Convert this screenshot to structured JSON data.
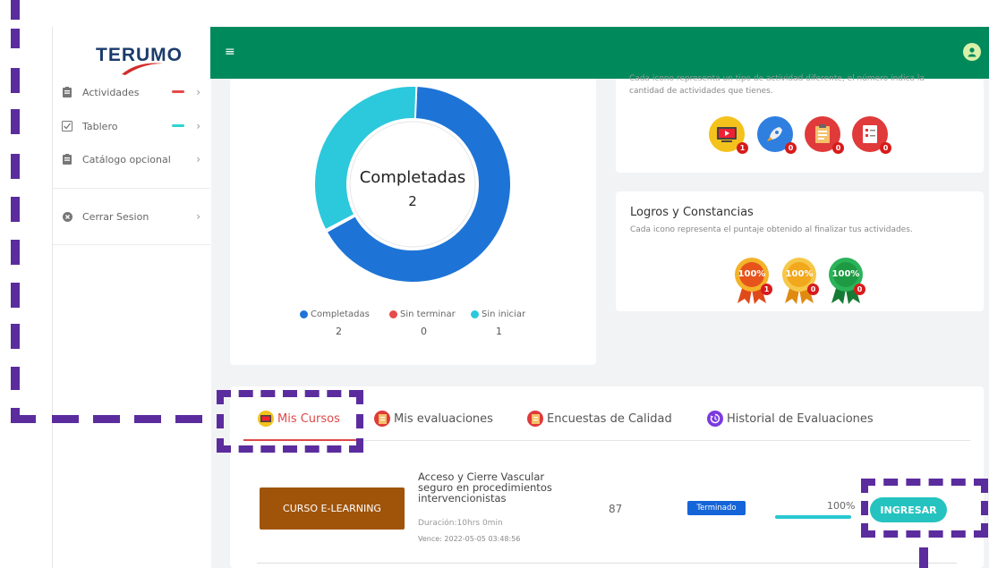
{
  "brand": {
    "name": "TERUMO",
    "accent": "#008a5c"
  },
  "sidebar": {
    "items": [
      {
        "label": "Actividades",
        "icon": "clipboard-icon",
        "indicator_color": "#e64a4a"
      },
      {
        "label": "Tablero",
        "icon": "checklist-icon",
        "indicator_color": "#2fd3d0"
      },
      {
        "label": "Catálogo opcional",
        "icon": "clipboard-icon"
      },
      {
        "label": "Cerrar Sesion",
        "icon": "close-circle-icon"
      }
    ]
  },
  "topbar": {
    "menu_icon": "hamburger-icon",
    "user_icon": "user-icon"
  },
  "chart_data": {
    "type": "pie",
    "center_label": "Completadas",
    "center_value": "2",
    "categories": [
      "Completadas",
      "Sin terminar",
      "Sin iniciar"
    ],
    "values": [
      2,
      0,
      1
    ],
    "colors": [
      "#1e74d6",
      "#e64a4a",
      "#2cc8dc"
    ],
    "legend_position": "bottom"
  },
  "activities": {
    "description_line1": "Cada icono representa un tipo de actividad diferente, el número indica la",
    "description_line2": "cantidad de actividades que tienes.",
    "icons": [
      {
        "name": "video-course-icon",
        "count": "1"
      },
      {
        "name": "rocket-icon",
        "count": "0"
      },
      {
        "name": "survey-icon",
        "count": "0"
      },
      {
        "name": "checklist-icon",
        "count": "0"
      }
    ]
  },
  "logros": {
    "title": "Logros y Constancias",
    "description": "Cada icono representa el puntaje obtenido al finalizar tus actividades.",
    "medals": [
      {
        "label": "100%",
        "count": "1",
        "color": "#e6541c"
      },
      {
        "label": "100%",
        "count": "0",
        "color": "#f2a81d"
      },
      {
        "label": "100%",
        "count": "0",
        "color": "#1e9a43"
      }
    ]
  },
  "tabs": [
    {
      "label": "Mis Cursos",
      "active": true
    },
    {
      "label": "Mis evaluaciones"
    },
    {
      "label": "Encuestas de Calidad"
    },
    {
      "label": "Historial de Evaluaciones"
    }
  ],
  "course": {
    "type_label": "CURSO E-LEARNING",
    "title": "Acceso y Cierre Vascular seguro en procedimientos intervencionistas",
    "duration": "Duración:10hrs 0min",
    "vence": "Vence: 2022-05-05 03:48:56",
    "score": "87",
    "status": "Terminado",
    "progress_label": "100%",
    "progress": 1.0,
    "action_label": "INGRESAR"
  }
}
